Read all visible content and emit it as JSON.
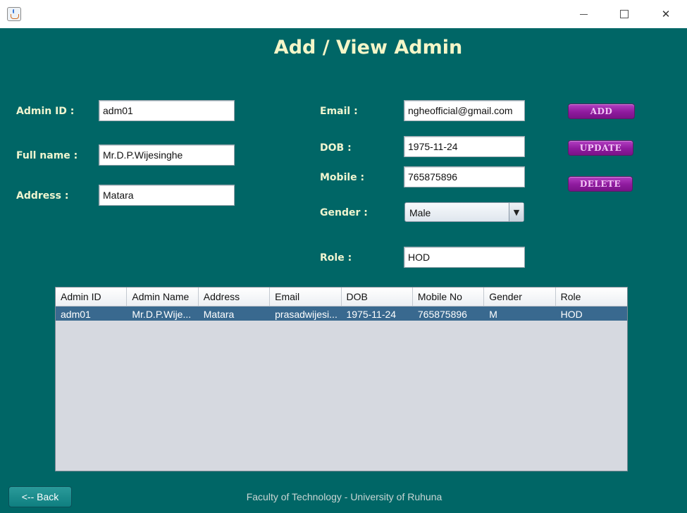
{
  "window": {
    "minimize_glyph": "",
    "maximize_glyph": "",
    "close_glyph": "✕"
  },
  "page": {
    "title": "Add / View Admin"
  },
  "form": {
    "admin_id": {
      "label": "Admin ID :",
      "value": "adm01"
    },
    "full_name": {
      "label": "Full name :",
      "value": "Mr.D.P.Wijesinghe"
    },
    "address": {
      "label": "Address :",
      "value": "Matara"
    },
    "email": {
      "label": "Email :",
      "value": "ngheofficial@gmail.com"
    },
    "dob": {
      "label": "DOB :",
      "value": "1975-11-24"
    },
    "mobile": {
      "label": "Mobile :",
      "value": "765875896"
    },
    "gender": {
      "label": "Gender :",
      "value": "Male"
    },
    "role": {
      "label": "Role :",
      "value": "HOD"
    }
  },
  "actions": {
    "add": "ADD",
    "update": "UPDATE",
    "delete": "DELETE"
  },
  "table": {
    "columns": [
      "Admin ID",
      "Admin Name",
      "Address",
      "Email",
      "DOB",
      "Mobile No",
      "Gender",
      "Role"
    ],
    "rows": [
      [
        "adm01",
        "Mr.D.P.Wije...",
        "Matara",
        "prasadwijesi...",
        "1975-11-24",
        "765875896",
        "M",
        "HOD"
      ]
    ]
  },
  "footer": {
    "back_label": "<-- Back",
    "credit": "Faculty of Technology - University of Ruhuna"
  },
  "colors": {
    "background": "#006666",
    "label_text": "#f0f5d0",
    "action_button": "#8e1a9d",
    "selected_row": "#39698f"
  },
  "icons": {
    "app": "java-app-icon",
    "combo_arrow": "▼"
  }
}
